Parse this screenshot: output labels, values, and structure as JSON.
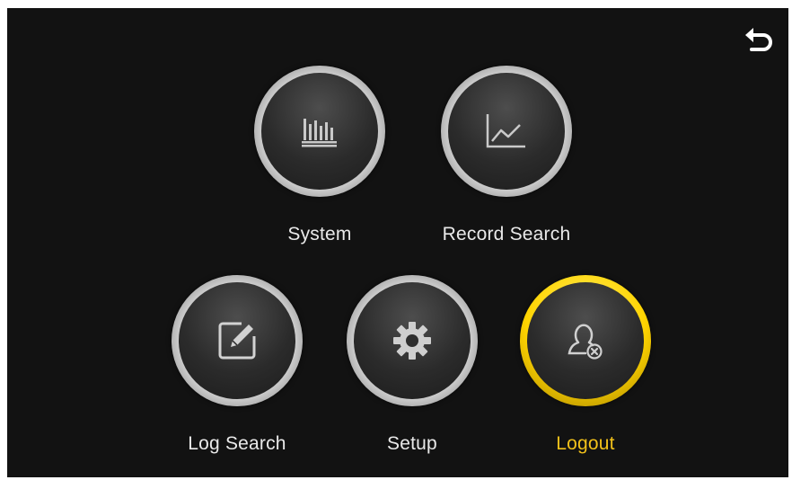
{
  "header": {
    "back_icon": "undo-arrow-icon"
  },
  "menu": {
    "items": [
      {
        "label": "System",
        "icon": "bar-chart-icon",
        "active": false
      },
      {
        "label": "Record Search",
        "icon": "line-chart-icon",
        "active": false
      },
      {
        "label": "Log Search",
        "icon": "edit-icon",
        "active": false
      },
      {
        "label": "Setup",
        "icon": "gear-icon",
        "active": false
      },
      {
        "label": "Logout",
        "icon": "user-logout-icon",
        "active": true
      }
    ]
  },
  "colors": {
    "background": "#121212",
    "label": "#e9e9e9",
    "active_label": "#f2c11a",
    "active_ring": "#ffd400"
  }
}
